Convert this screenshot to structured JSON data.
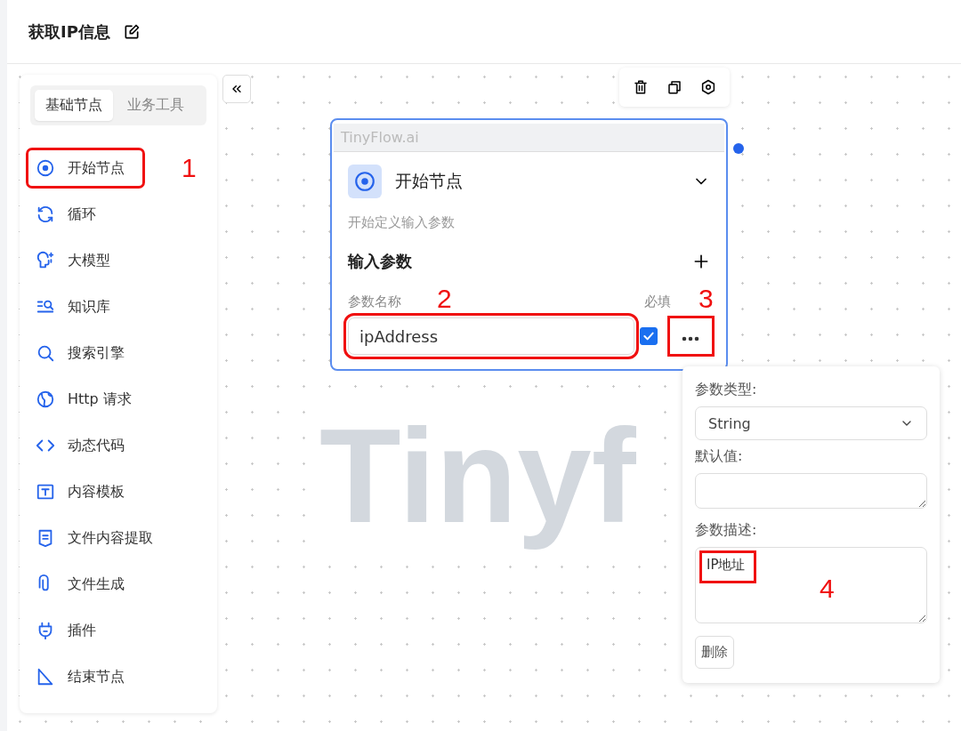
{
  "header": {
    "title": "获取IP信息"
  },
  "sidebar": {
    "tabs": [
      {
        "label": "基础节点",
        "selected": true
      },
      {
        "label": "业务工具",
        "selected": false
      }
    ],
    "items": [
      {
        "label": "开始节点",
        "annotation": "1"
      },
      {
        "label": "循环"
      },
      {
        "label": "大模型"
      },
      {
        "label": "知识库"
      },
      {
        "label": "搜索引擎"
      },
      {
        "label": "Http 请求"
      },
      {
        "label": "动态代码"
      },
      {
        "label": "内容模板"
      },
      {
        "label": "文件内容提取"
      },
      {
        "label": "文件生成"
      },
      {
        "label": "插件"
      },
      {
        "label": "结束节点"
      }
    ]
  },
  "canvas": {
    "watermark": "Tinyf"
  },
  "node": {
    "brand": "TinyFlow.ai",
    "title": "开始节点",
    "expanded": true,
    "description": "开始定义输入参数",
    "section": "输入参数",
    "name_label": "参数名称",
    "required_label": "必填",
    "params": [
      {
        "name": "ipAddress",
        "required": true,
        "annotation": "2",
        "more_annotation": "3"
      }
    ]
  },
  "popover": {
    "type_label": "参数类型:",
    "type_value": "String",
    "default_label": "默认值:",
    "desc_label": "参数描述:",
    "desc_value": "IP地址",
    "desc_annotation": "4",
    "delete": "删除"
  }
}
